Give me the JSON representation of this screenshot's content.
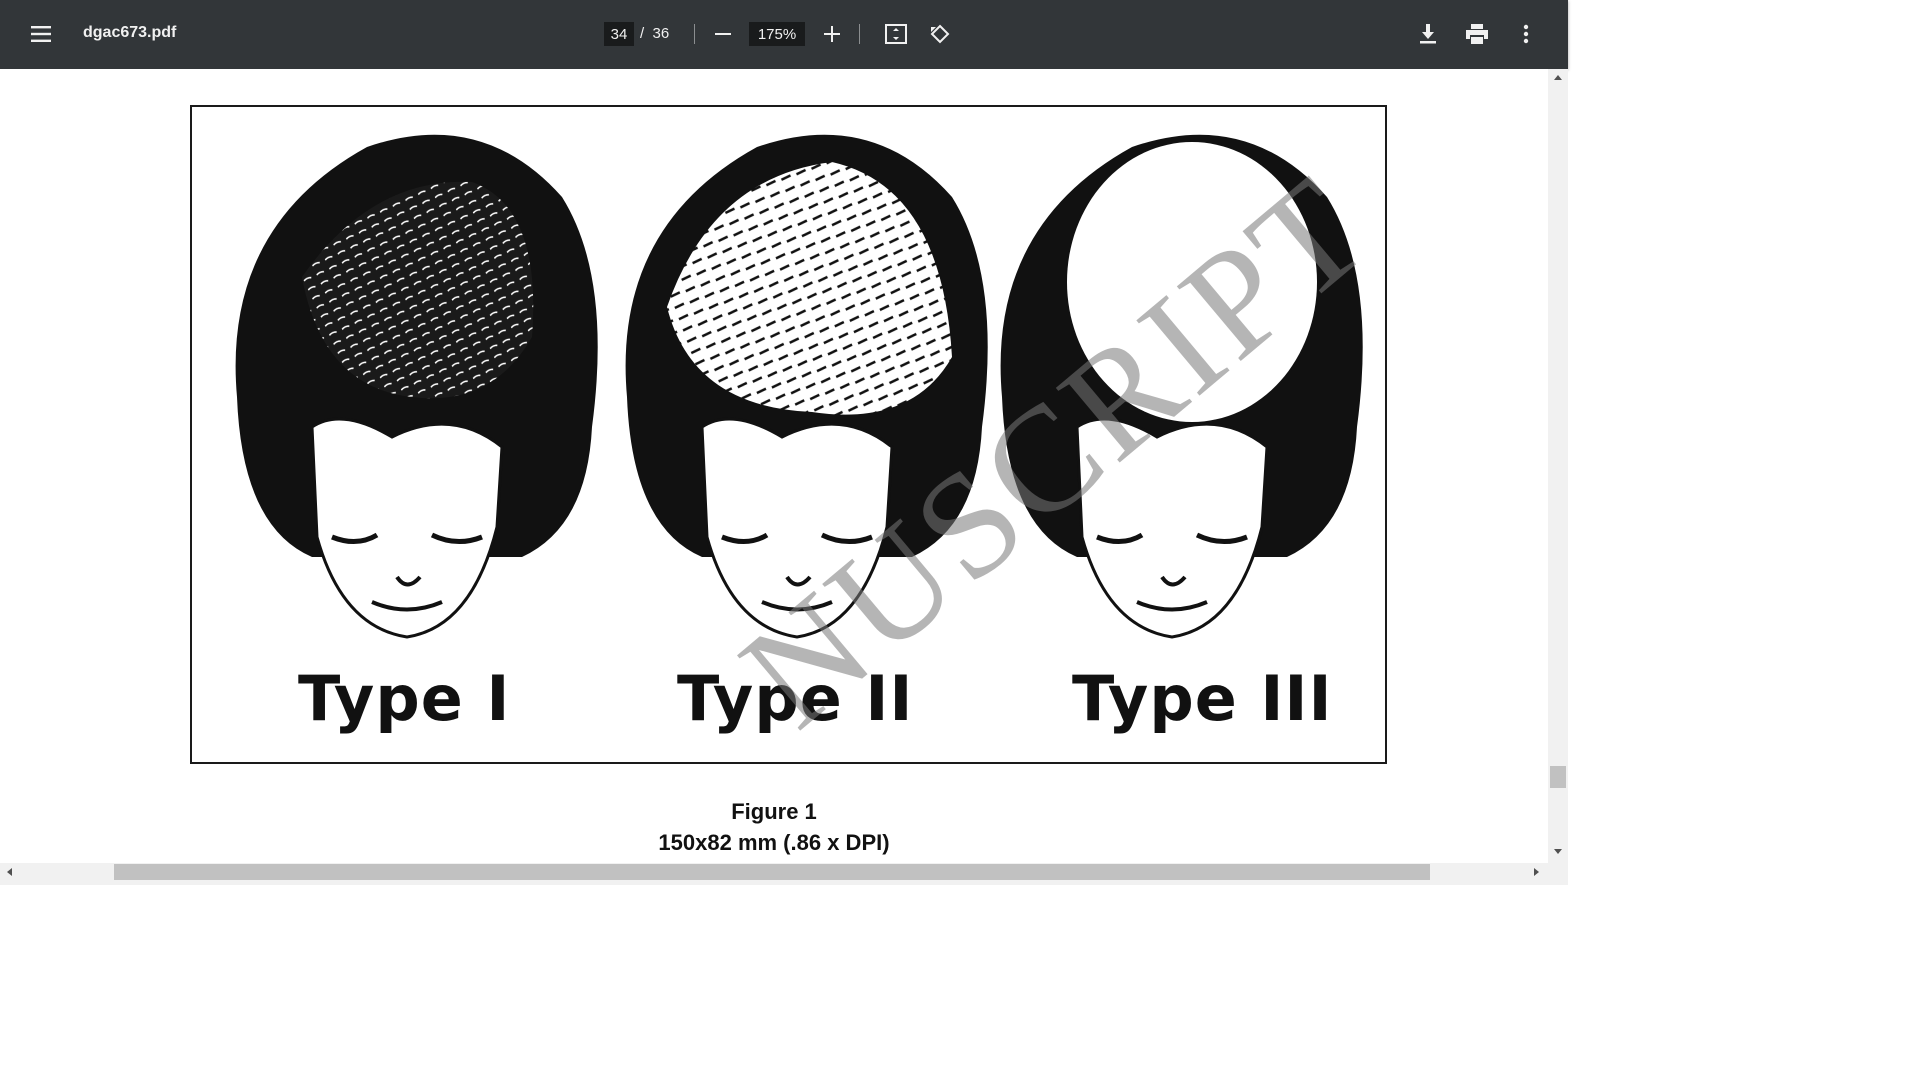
{
  "toolbar": {
    "title": "dgac673.pdf",
    "page_current": "34",
    "page_total": "/  36",
    "zoom": "175%"
  },
  "figure": {
    "labels": [
      "Type I",
      "Type II",
      "Type III"
    ],
    "caption_title": "Figure 1",
    "caption_size": "150x82 mm (.86 x  DPI)"
  },
  "watermark": "NUSCRIPT",
  "icons": {
    "menu": "menu-icon",
    "zoom_out": "minus-icon",
    "zoom_in": "plus-icon",
    "fit": "fit-page-icon",
    "rotate": "rotate-icon",
    "download": "download-icon",
    "print": "print-icon",
    "more": "more-vert-icon"
  }
}
